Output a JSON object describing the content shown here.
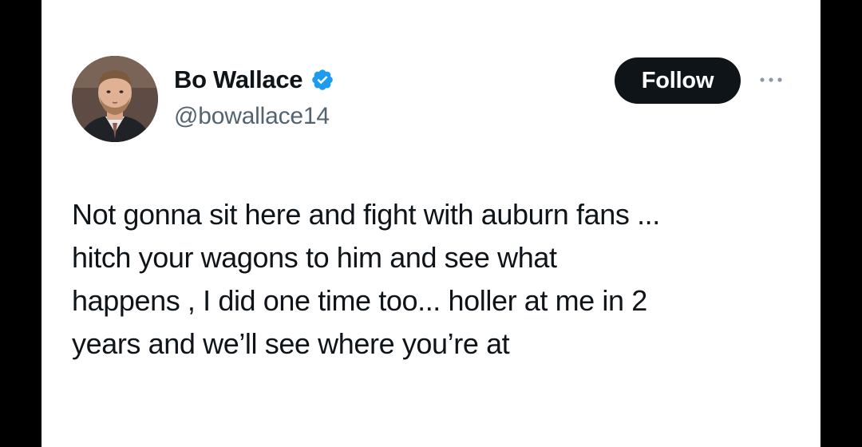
{
  "tweet": {
    "author": {
      "display_name": "Bo Wallace",
      "handle": "@bowallace14",
      "verified": true,
      "verified_color": "#1d9bf0",
      "avatar_icon": "profile-photo"
    },
    "follow_label": "Follow",
    "more_icon": "more-horizontal-icon",
    "text_lines": [
      "Not gonna sit here and fight with auburn fans ...",
      "hitch your wagons to him and see what",
      "happens , I did one time too... holler at me in 2",
      "years and we’ll see where you’re at"
    ]
  },
  "colors": {
    "background": "#ffffff",
    "frame": "#000000",
    "text": "#0f1419",
    "secondary_text": "#536471",
    "button": "#0f1419"
  }
}
